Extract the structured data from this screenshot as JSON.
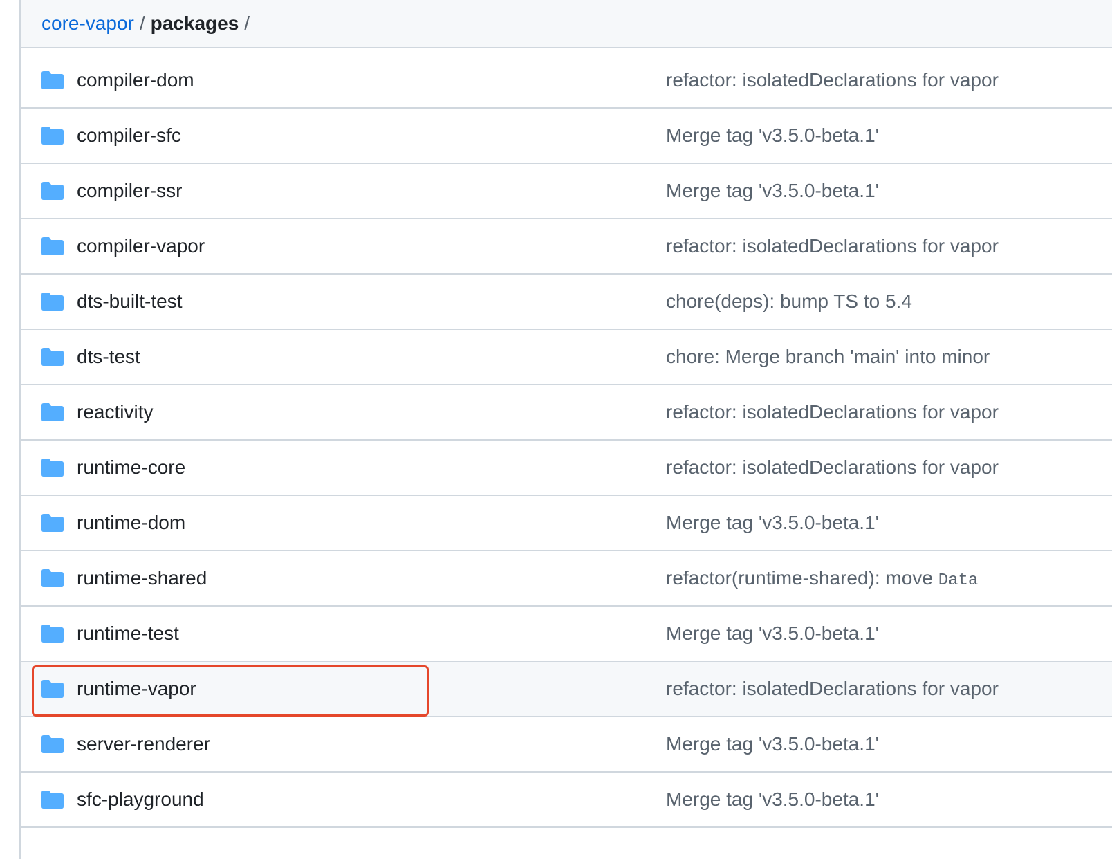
{
  "breadcrumb": {
    "repo": "core-vapor",
    "separator": "/",
    "current": "packages",
    "trailing_separator": "/"
  },
  "colors": {
    "folder_icon": "#54aeff",
    "link": "#0969da",
    "highlight": "#e5472b"
  },
  "files": [
    {
      "name": "compiler-dom",
      "icon": "folder-icon",
      "commit": "refactor: isolatedDeclarations for vapor",
      "commit_code": ""
    },
    {
      "name": "compiler-sfc",
      "icon": "folder-icon",
      "commit": "Merge tag 'v3.5.0-beta.1'",
      "commit_code": ""
    },
    {
      "name": "compiler-ssr",
      "icon": "folder-icon",
      "commit": "Merge tag 'v3.5.0-beta.1'",
      "commit_code": ""
    },
    {
      "name": "compiler-vapor",
      "icon": "folder-icon",
      "commit": "refactor: isolatedDeclarations for vapor",
      "commit_code": ""
    },
    {
      "name": "dts-built-test",
      "icon": "folder-icon",
      "commit": "chore(deps): bump TS to 5.4",
      "commit_code": ""
    },
    {
      "name": "dts-test",
      "icon": "folder-icon",
      "commit": "chore: Merge branch 'main' into minor",
      "commit_code": ""
    },
    {
      "name": "reactivity",
      "icon": "folder-icon",
      "commit": "refactor: isolatedDeclarations for vapor",
      "commit_code": ""
    },
    {
      "name": "runtime-core",
      "icon": "folder-icon",
      "commit": "refactor: isolatedDeclarations for vapor",
      "commit_code": ""
    },
    {
      "name": "runtime-dom",
      "icon": "folder-icon",
      "commit": "Merge tag 'v3.5.0-beta.1'",
      "commit_code": ""
    },
    {
      "name": "runtime-shared",
      "icon": "folder-icon",
      "commit": "refactor(runtime-shared): move ",
      "commit_code": "Data"
    },
    {
      "name": "runtime-test",
      "icon": "folder-icon",
      "commit": "Merge tag 'v3.5.0-beta.1'",
      "commit_code": ""
    },
    {
      "name": "runtime-vapor",
      "icon": "folder-icon",
      "commit": "refactor: isolatedDeclarations for vapor",
      "commit_code": "",
      "hovered": true,
      "highlighted": true
    },
    {
      "name": "server-renderer",
      "icon": "folder-icon",
      "commit": "Merge tag 'v3.5.0-beta.1'",
      "commit_code": ""
    },
    {
      "name": "sfc-playground",
      "icon": "folder-icon",
      "commit": "Merge tag 'v3.5.0-beta.1'",
      "commit_code": ""
    }
  ]
}
